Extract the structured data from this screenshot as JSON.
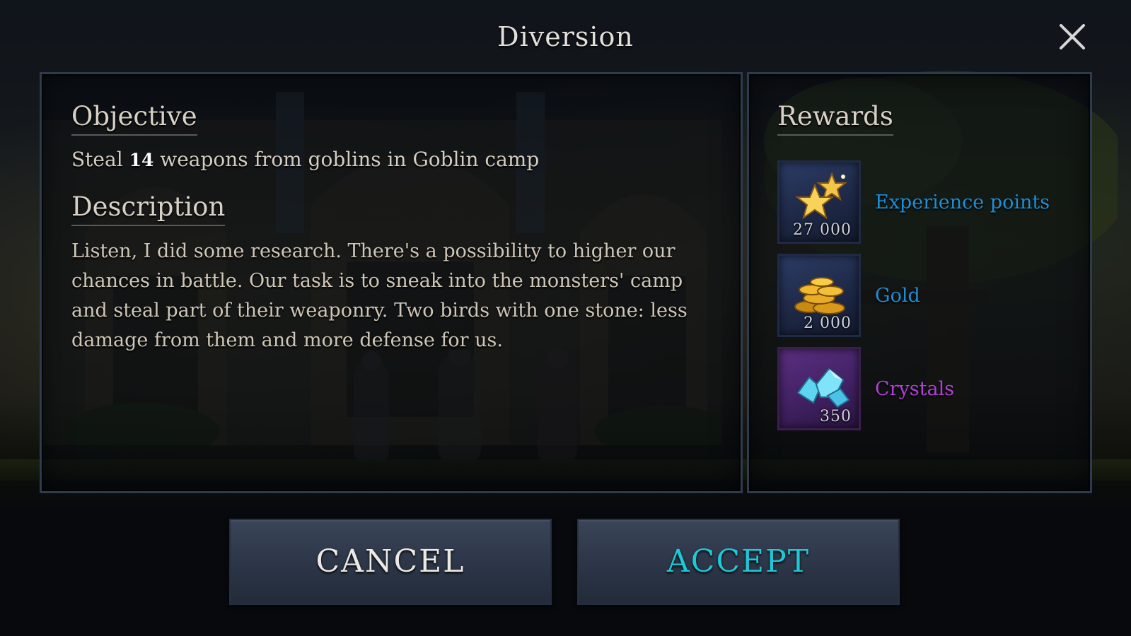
{
  "dialog": {
    "title": "Diversion",
    "close_icon": "close-icon"
  },
  "objective": {
    "heading": "Objective",
    "text_before": "Steal",
    "count": "14",
    "text_after": "weapons from goblins in Goblin camp"
  },
  "description": {
    "heading": "Description",
    "text": "Listen, I did some research. There's a possibility to higher our chances in battle. Our task is to sneak into the monsters' camp and steal part of their weaponry. Two birds with one stone: less damage from them and more defense for us."
  },
  "rewards": {
    "heading": "Rewards",
    "items": [
      {
        "label": "Experience points",
        "amount": "27 000",
        "icon": "stars-icon",
        "color": "#1d8fd8"
      },
      {
        "label": "Gold",
        "amount": "2 000",
        "icon": "gold-coins-icon",
        "color": "#1d8fd8"
      },
      {
        "label": "Crystals",
        "amount": "350",
        "icon": "crystals-icon",
        "color": "#b23fd6"
      }
    ]
  },
  "buttons": {
    "cancel_label": "CANCEL",
    "accept_label": "ACCEPT",
    "accept_color": "#1ec8d8"
  }
}
